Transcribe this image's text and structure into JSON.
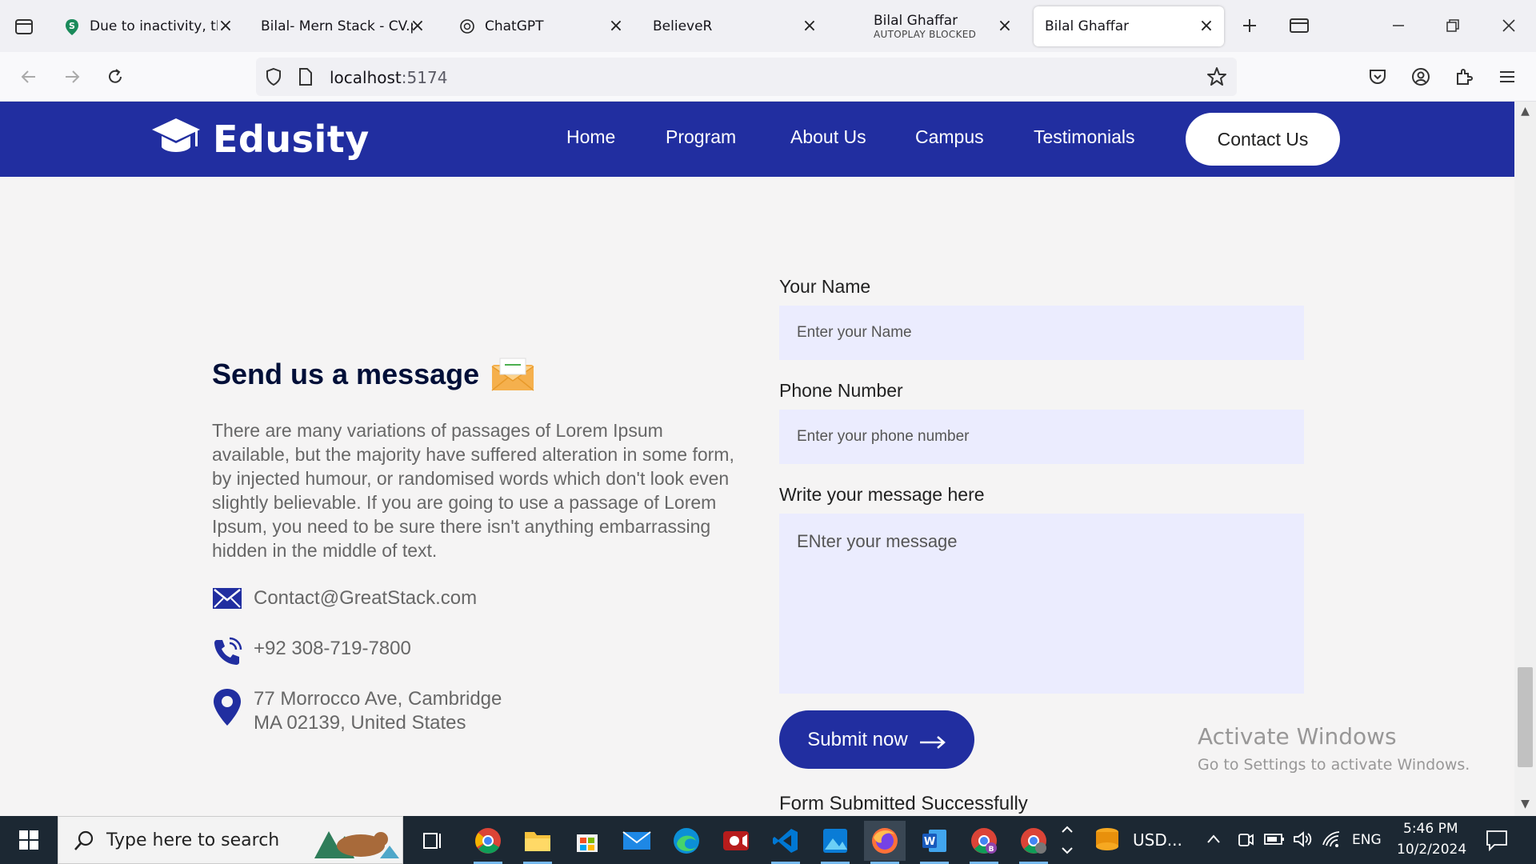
{
  "browser": {
    "tabs": [
      {
        "title": "Due to inactivity, the",
        "sub": ""
      },
      {
        "title": "Bilal- Mern Stack - CV.p",
        "sub": ""
      },
      {
        "title": "ChatGPT",
        "sub": ""
      },
      {
        "title": "BelieveR",
        "sub": ""
      },
      {
        "title": "Bilal Ghaffar",
        "sub": "AUTOPLAY BLOCKED"
      },
      {
        "title": "Bilal Ghaffar",
        "sub": ""
      }
    ],
    "url_host": "localhost",
    "url_port": ":5174"
  },
  "site": {
    "logo_text": "Edusity",
    "nav": [
      "Home",
      "Program",
      "About Us",
      "Campus",
      "Testimonials"
    ],
    "contact_button": "Contact Us"
  },
  "contact": {
    "heading": "Send us a message",
    "paragraph": "There are many variations of passages of Lorem Ipsum available, but the majority have suffered alteration in some form, by injected humour, or randomised words which don't look even slightly believable. If you are going to use a passage of Lorem Ipsum, you need to be sure there isn't anything embarrassing hidden in the middle of text.",
    "email": "Contact@GreatStack.com",
    "phone": "+92 308-719-7800",
    "address_line1": "77 Morrocco Ave, Cambridge",
    "address_line2": "MA 02139, United States"
  },
  "form": {
    "name_label": "Your Name",
    "name_placeholder": "Enter your Name",
    "phone_label": "Phone Number",
    "phone_placeholder": "Enter your phone number",
    "message_label": "Write your message here",
    "message_placeholder": "ENter your message",
    "submit_label": "Submit now",
    "result": "Form Submitted Successfully"
  },
  "watermark": {
    "line1": "Activate Windows",
    "line2": "Go to Settings to activate Windows."
  },
  "taskbar": {
    "search_placeholder": "Type here to search",
    "weather": "USD...",
    "language": "ENG",
    "time": "5:46 PM",
    "date": "10/2/2024"
  },
  "colors": {
    "brand": "#212ea0",
    "input_bg": "#ebecfe",
    "heading": "#000f38"
  }
}
